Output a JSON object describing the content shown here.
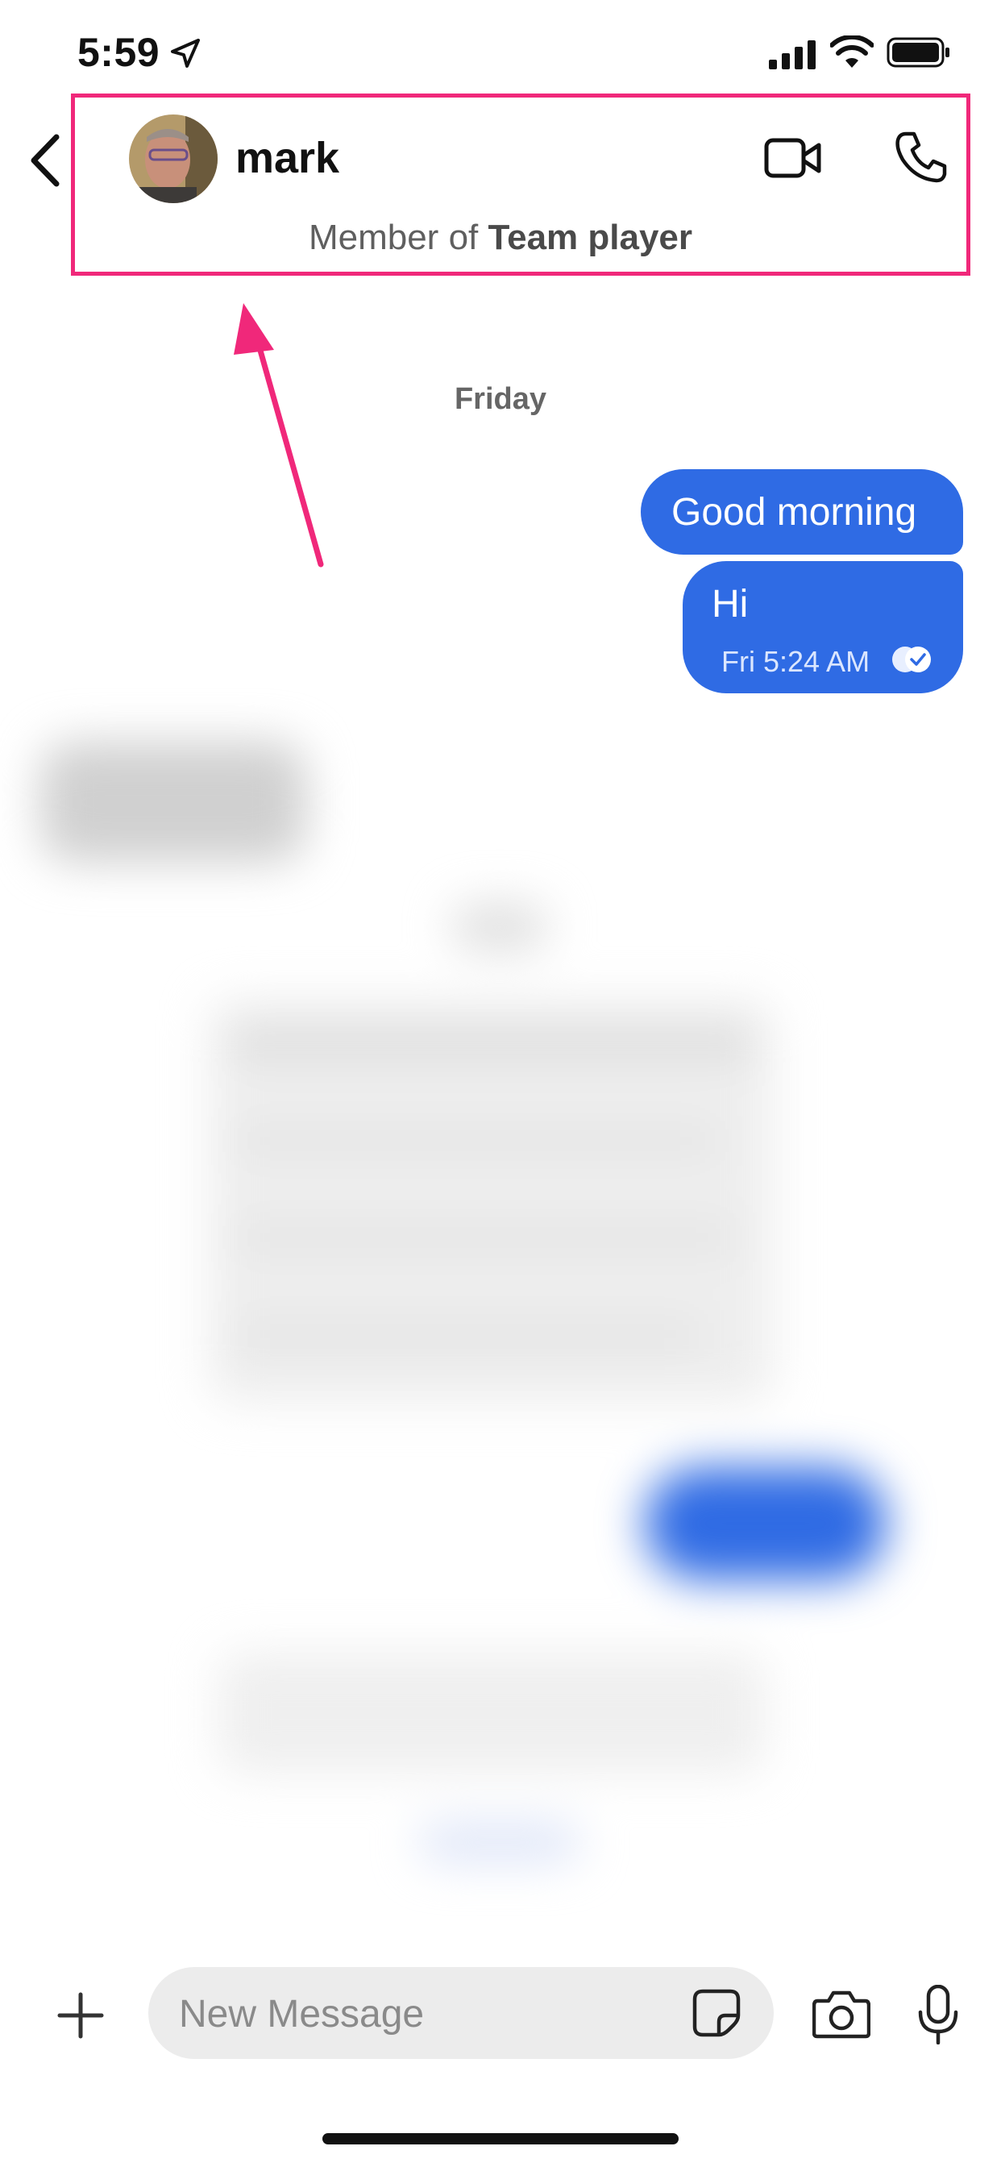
{
  "status_bar": {
    "time": "5:59"
  },
  "header": {
    "contact_name": "mark",
    "member_prefix": "Member of ",
    "group_name": "Team player"
  },
  "conversation": {
    "day_label": "Friday",
    "messages": [
      {
        "text": "Good morning"
      },
      {
        "text": "Hi",
        "meta": "Fri 5:24 AM"
      }
    ]
  },
  "composer": {
    "placeholder": "New Message"
  },
  "colors": {
    "bubble": "#2f6be4",
    "highlight": "#f0287a"
  },
  "icons": [
    "back-icon",
    "video-call-icon",
    "phone-icon",
    "plus-icon",
    "sticker-icon",
    "camera-icon",
    "microphone-icon",
    "location-arrow-icon",
    "signal-icon",
    "wifi-icon",
    "battery-icon",
    "read-receipt-icon"
  ]
}
